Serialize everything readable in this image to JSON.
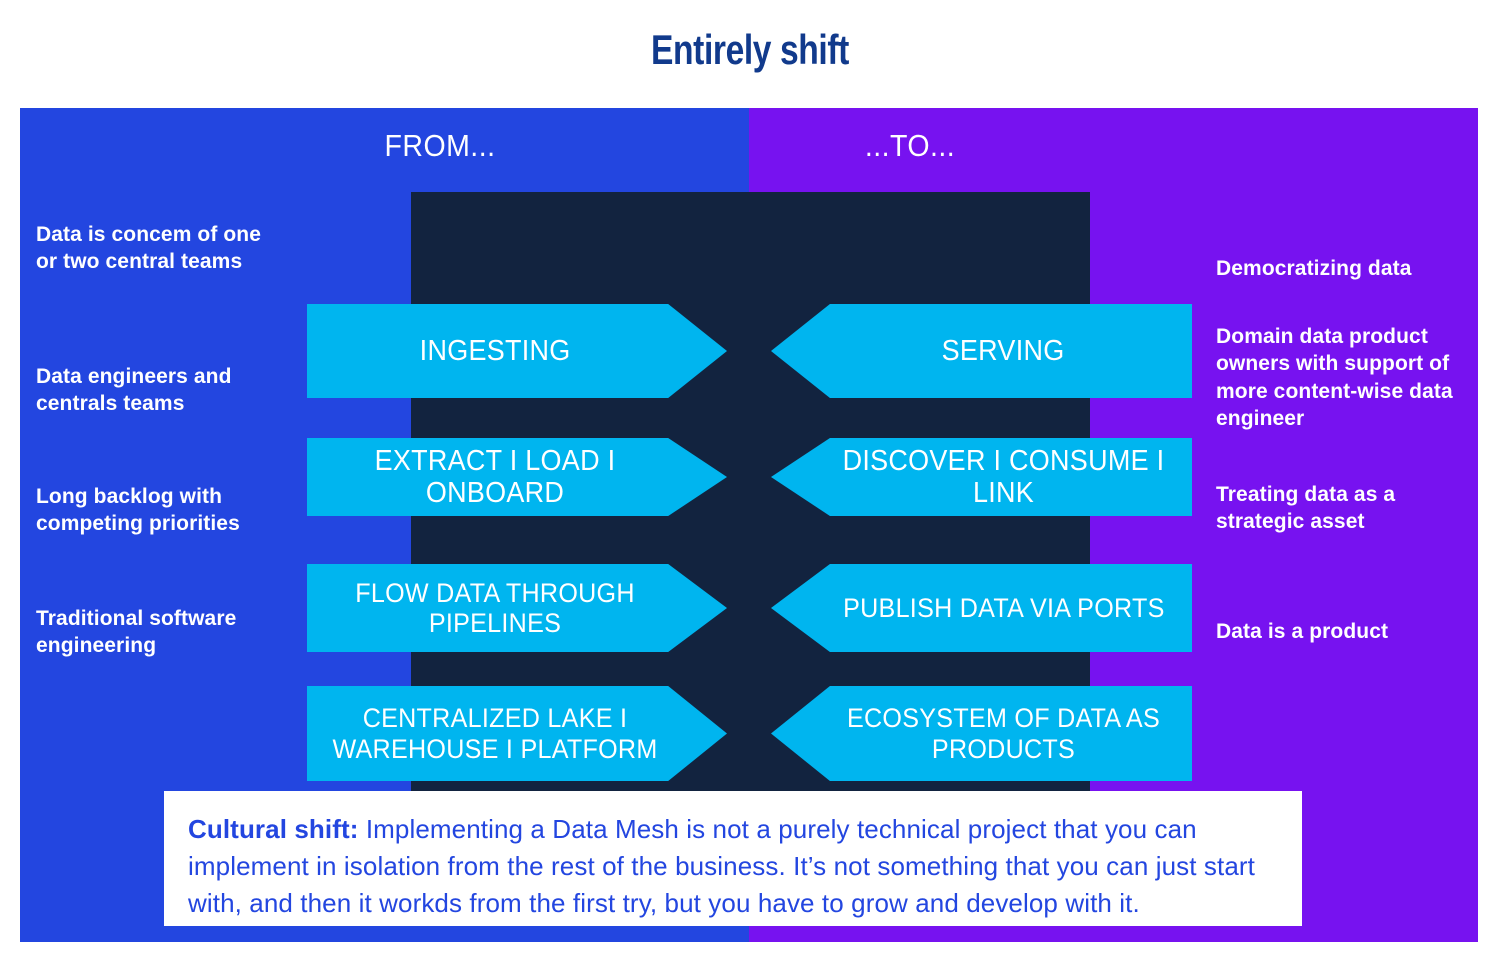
{
  "title": "Entirely shift",
  "columns": {
    "from_label": "FROM...",
    "to_label": "...TO..."
  },
  "left_labels": [
    "Data is concem of one or two central teams",
    "Data engineers and centrals teams",
    "Long backlog with competing priorities",
    "Traditional software engineering"
  ],
  "right_labels": [
    "Democratizing data",
    "Domain data product owners with support of more content-wise data engineer",
    "Treating data as a strategic asset",
    "Data is a product"
  ],
  "rows": [
    {
      "from": "INGESTING",
      "to": "SERVING"
    },
    {
      "from": "EXTRACT I LOAD I ONBOARD",
      "to": "DISCOVER I CONSUME I LINK"
    },
    {
      "from": "FLOW DATA THROUGH PIPELINES",
      "to": "PUBLISH DATA VIA PORTS"
    },
    {
      "from": "CENTRALIZED LAKE I WAREHOUSE I PLATFORM",
      "to": "ECOSYSTEM OF DATA AS PRODUCTS"
    }
  ],
  "note": {
    "lead": "Cultural shift:",
    "body": "Implementing a Data Mesh is not a purely technical project that you can implement in isolation from the rest of the business. It’s not something that you can just start with, and then it workds from the first try, but you have to grow and develop with it."
  },
  "icons": {
    "transition_arrow": "curved-arrow-right-icon"
  },
  "colors": {
    "title": "#113a8c",
    "left_half": "#2346E0",
    "right_half": "#7712F0",
    "chevron": "#00B5EF",
    "dark_panel": "#12233F",
    "note_bg": "#FFFFFF",
    "note_text": "#2346E0",
    "arrow": "#FFFFFF"
  }
}
